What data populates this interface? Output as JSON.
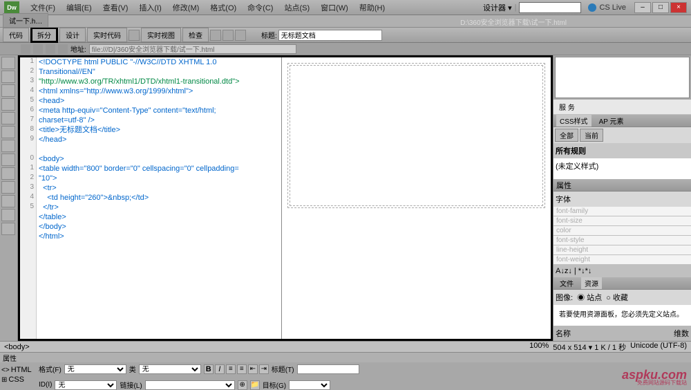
{
  "logo": "Dw",
  "menus": [
    "文件(F)",
    "编辑(E)",
    "查看(V)",
    "插入(I)",
    "修改(M)",
    "格式(O)",
    "命令(C)",
    "站点(S)",
    "窗口(W)",
    "帮助(H)"
  ],
  "designer": "设计器 ▾",
  "cslive": "CS Live",
  "docTab": "试一下.h…",
  "docPath": "D:\\360安全浏览器下载\\试一下.html",
  "viewBtns": [
    "代码",
    "拆分",
    "设计",
    "实时代码",
    "实时视图",
    "检查"
  ],
  "titleLabel": "标题:",
  "titleValue": "无标题文档",
  "addrLabel": "地址:",
  "addrValue": "file:///D|/360安全浏览器下载/试一下.html",
  "lineNums": [
    "1",
    "2",
    "3",
    "4",
    "5",
    "6",
    "7",
    "8",
    "9",
    "",
    "0",
    "1",
    "2",
    "3",
    "4",
    "5"
  ],
  "code": [
    {
      "t": "<!DOCTYPE html PUBLIC \"-//W3C//DTD XHTML 1.0",
      "c": "blue"
    },
    {
      "t": "Transitional//EN\"",
      "c": "blue"
    },
    {
      "t": "\"http://www.w3.org/TR/xhtml1/DTD/xhtml1-transitional.dtd\">",
      "c": "green"
    },
    {
      "t": "<html xmlns=\"http://www.w3.org/1999/xhtml\">",
      "c": "blue"
    },
    {
      "t": "<head>",
      "c": "blue"
    },
    {
      "t": "<meta http-equiv=\"Content-Type\" content=\"text/html;",
      "c": "blue"
    },
    {
      "t": "charset=utf-8\" />",
      "c": "blue"
    },
    {
      "t": "<title>无标题文档</title>",
      "c": "blue"
    },
    {
      "t": "</head>",
      "c": "blue"
    },
    {
      "t": "",
      "c": "black"
    },
    {
      "t": "<body>",
      "c": "blue"
    },
    {
      "t": "<table width=\"800\" border=\"0\" cellspacing=\"0\" cellpadding=",
      "c": "blue"
    },
    {
      "t": "\"10\">",
      "c": "blue"
    },
    {
      "t": "  <tr>",
      "c": "blue"
    },
    {
      "t": "    <td height=\"260\">&nbsp;</td>",
      "c": "blue"
    },
    {
      "t": "  </tr>",
      "c": "blue"
    },
    {
      "t": "</table>",
      "c": "blue"
    },
    {
      "t": "</body>",
      "c": "blue"
    },
    {
      "t": "</html>",
      "c": "blue"
    }
  ],
  "cssPanel": {
    "tabs": [
      "CSS样式",
      "AP 元素"
    ],
    "btns": [
      "全部",
      "当前"
    ],
    "ruleHdr": "所有规则",
    "ruleBody": "(未定义样式)"
  },
  "propPanel": {
    "hdr": "属性",
    "font": "字体",
    "props": [
      "font-family",
      "font-size",
      "color",
      "font-style",
      "line-height",
      "font-weight"
    ],
    "azBtn": "A↓z↓ | *↓*↓"
  },
  "filesPanel": {
    "tabs": [
      "文件",
      "资源"
    ],
    "imgLabel": "图像:",
    "site": "◉ 站点",
    "fav": "○ 收藏",
    "msg": "若要使用资源面板，您必须先定义站点。",
    "cols": [
      "名称",
      "维数"
    ]
  },
  "shu": "服 务",
  "statusTag": "<body>",
  "statusInfo": [
    "100%",
    "504 x 514 ▾ 1 K / 1 秒",
    "Unicode (UTF-8)"
  ],
  "propInspect": {
    "hdr": "属性",
    "modes": [
      "HTML",
      "CSS"
    ],
    "format": "格式(F)",
    "formatVal": "无",
    "id": "ID(I)",
    "idVal": "无",
    "cls": "类",
    "clsVal": "无",
    "link": "链接(L)",
    "title": "标题(T)",
    "target": "目标(G)"
  },
  "watermark": "aspku.com",
  "watermarkSub": "免费网站源码下载站"
}
